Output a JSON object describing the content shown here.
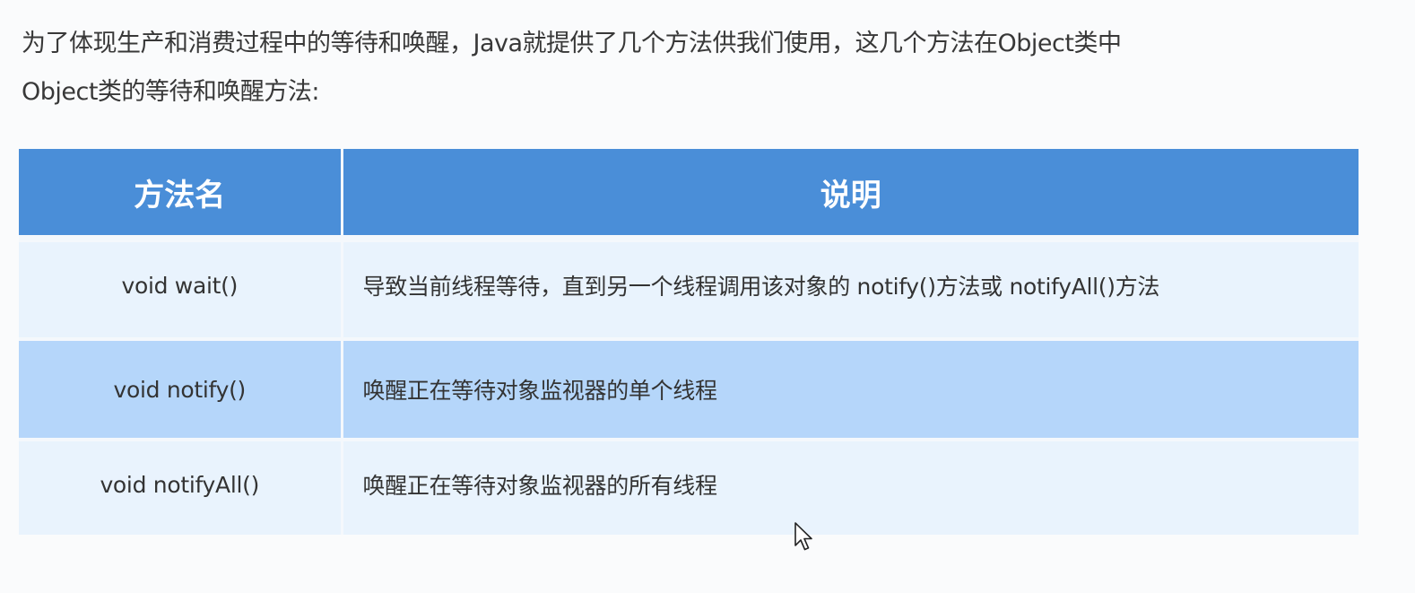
{
  "intro": {
    "line1": "为了体现生产和消费过程中的等待和唤醒，Java就提供了几个方法供我们使用，这几个方法在Object类中",
    "line2": "Object类的等待和唤醒方法:"
  },
  "table": {
    "headers": [
      "方法名",
      "说明"
    ],
    "rows": [
      {
        "name": "void wait()",
        "description": "导致当前线程等待，直到另一个线程调用该对象的 notify()方法或 notifyAll()方法"
      },
      {
        "name": "void notify()",
        "description": "唤醒正在等待对象监视器的单个线程"
      },
      {
        "name": "void notifyAll()",
        "description": "唤醒正在等待对象监视器的所有线程"
      }
    ],
    "colors": {
      "header_bg": "#4a8ed8",
      "row_light": "#e9f3fd",
      "row_highlight": "#b5d6fa"
    }
  },
  "cursor_icon": "mouse-pointer-icon"
}
